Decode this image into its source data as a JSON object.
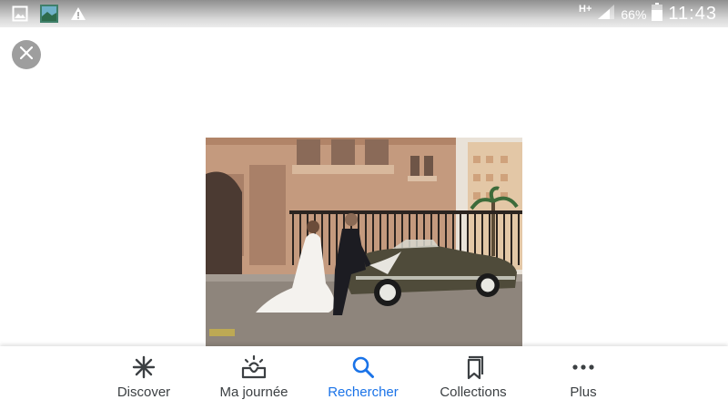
{
  "status_bar": {
    "network": "H+",
    "battery": "66%",
    "time": "11:43",
    "icons": [
      "gallery-icon",
      "app-thumbnail-icon",
      "warning-icon",
      "signal-icon",
      "battery-icon"
    ]
  },
  "viewer": {
    "close_icon": "close-icon",
    "photo": "wedding couple sitting on vintage convertible car in front of ornate stone building"
  },
  "bottom_nav": {
    "active_color": "#1a73e8",
    "items": [
      {
        "label": "Discover",
        "icon": "asterisk-icon"
      },
      {
        "label": "Ma journée",
        "icon": "inbox-sun-icon"
      },
      {
        "label": "Rechercher",
        "icon": "search-icon"
      },
      {
        "label": "Collections",
        "icon": "bookmarks-icon"
      },
      {
        "label": "Plus",
        "icon": "more-dots-icon"
      }
    ]
  }
}
